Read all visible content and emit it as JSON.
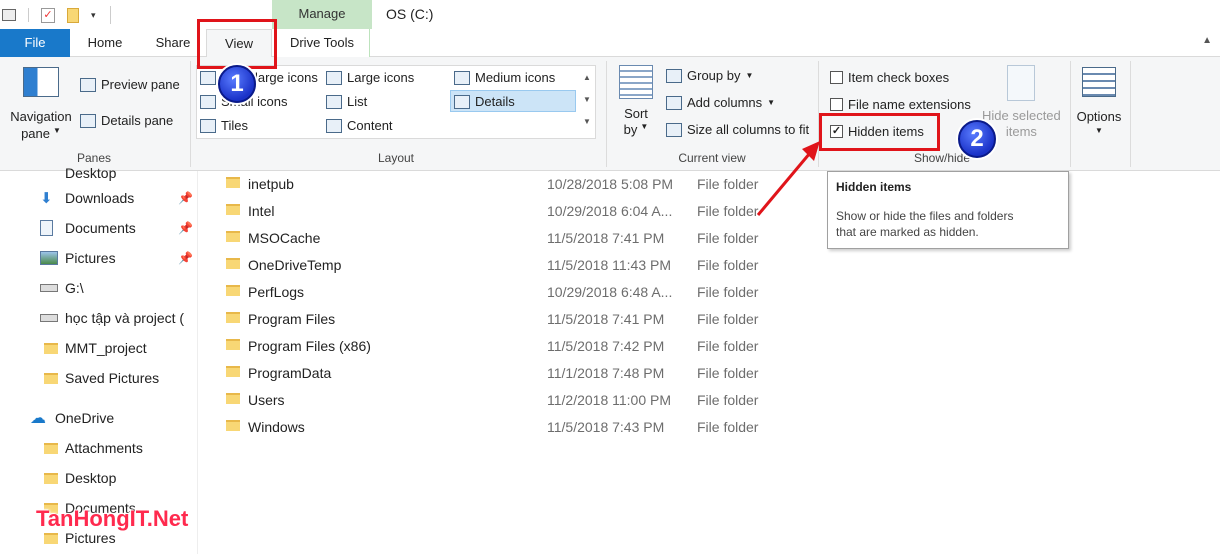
{
  "window": {
    "title": "OS (C:)",
    "contextual_tab": "Manage"
  },
  "tabs": {
    "file": "File",
    "home": "Home",
    "share": "Share",
    "view": "View",
    "drive_tools": "Drive Tools"
  },
  "ribbon": {
    "panes": {
      "label": "Panes",
      "navigation_pane": "Navigation",
      "navigation_pane_2": "pane",
      "preview_pane": "Preview pane",
      "details_pane": "Details pane"
    },
    "layout": {
      "label": "Layout",
      "items": [
        "Extra large icons",
        "Large icons",
        "Medium icons",
        "Small icons",
        "List",
        "Details",
        "Tiles",
        "Content"
      ],
      "selected": "Details"
    },
    "current_view": {
      "label": "Current view",
      "sort_by": "Sort",
      "sort_by_2": "by",
      "group_by": "Group by",
      "add_columns": "Add columns",
      "size_all": "Size all columns to fit"
    },
    "show_hide": {
      "label": "Show/hide",
      "item_check_boxes": "Item check boxes",
      "file_name_extensions": "File name extensions",
      "hidden_items": "Hidden items",
      "hide_selected": "Hide selected",
      "hide_selected_2": "items"
    },
    "options": "Options"
  },
  "nav": {
    "items": [
      {
        "label": "Desktop"
      },
      {
        "label": "Downloads",
        "pinned": true
      },
      {
        "label": "Documents",
        "pinned": true
      },
      {
        "label": "Pictures",
        "pinned": true
      },
      {
        "label": "G:\\"
      },
      {
        "label": "học tập và project ("
      },
      {
        "label": "MMT_project"
      },
      {
        "label": "Saved Pictures"
      },
      {
        "label": "OneDrive"
      },
      {
        "label": "Attachments"
      },
      {
        "label": "Desktop"
      },
      {
        "label": "Documents"
      },
      {
        "label": "Pictures"
      }
    ]
  },
  "files": [
    {
      "name": "inetpub",
      "date": "10/28/2018 5:08 PM",
      "type": "File folder"
    },
    {
      "name": "Intel",
      "date": "10/29/2018 6:04 A...",
      "type": "File folder"
    },
    {
      "name": "MSOCache",
      "date": "11/5/2018 7:41 PM",
      "type": "File folder"
    },
    {
      "name": "OneDriveTemp",
      "date": "11/5/2018 11:43 PM",
      "type": "File folder"
    },
    {
      "name": "PerfLogs",
      "date": "10/29/2018 6:48 A...",
      "type": "File folder"
    },
    {
      "name": "Program Files",
      "date": "11/5/2018 7:41 PM",
      "type": "File folder"
    },
    {
      "name": "Program Files (x86)",
      "date": "11/5/2018 7:42 PM",
      "type": "File folder"
    },
    {
      "name": "ProgramData",
      "date": "11/1/2018 7:48 PM",
      "type": "File folder"
    },
    {
      "name": "Users",
      "date": "11/2/2018 11:00 PM",
      "type": "File folder"
    },
    {
      "name": "Windows",
      "date": "11/5/2018 7:43 PM",
      "type": "File folder"
    }
  ],
  "tooltip": {
    "title": "Hidden items",
    "body_1": "Show or hide the files and folders",
    "body_2": "that are marked as hidden."
  },
  "annotations": {
    "step1": "1",
    "step2": "2"
  },
  "watermark": "TanHongIT.Net",
  "colors": {
    "file_tab": "#1979ca",
    "manage_tab": "#c7e5c7",
    "annotation_red": "#e0141a",
    "selection": "#cce4f7"
  }
}
